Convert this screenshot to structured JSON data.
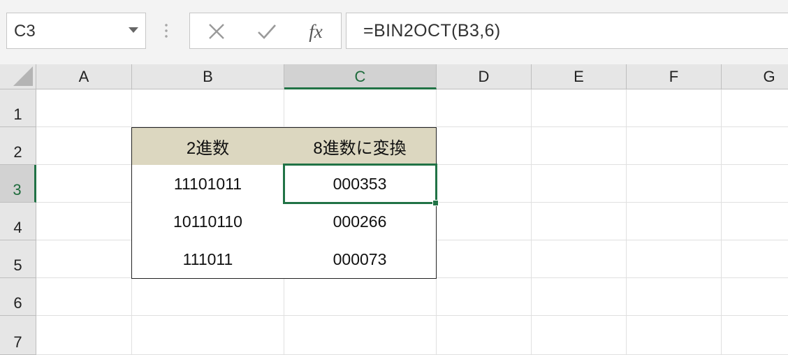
{
  "name_box": {
    "value": "C3"
  },
  "formula_bar": {
    "cancel_icon": "cancel-x-icon",
    "enter_icon": "checkmark-icon",
    "fx_label": "fx",
    "formula": "=BIN2OCT(B3,6)"
  },
  "columns": [
    "A",
    "B",
    "C",
    "D",
    "E",
    "F",
    "G"
  ],
  "rows": [
    "1",
    "2",
    "3",
    "4",
    "5",
    "6",
    "7"
  ],
  "selected_cell": "C3",
  "table": {
    "headers": [
      "2進数",
      "8進数に変換"
    ],
    "rows": [
      [
        "11101011",
        "000353"
      ],
      [
        "10110110",
        "000266"
      ],
      [
        "111011",
        "000073"
      ]
    ]
  },
  "colors": {
    "header_fill": "#dcd7c0",
    "selection": "#217346"
  }
}
